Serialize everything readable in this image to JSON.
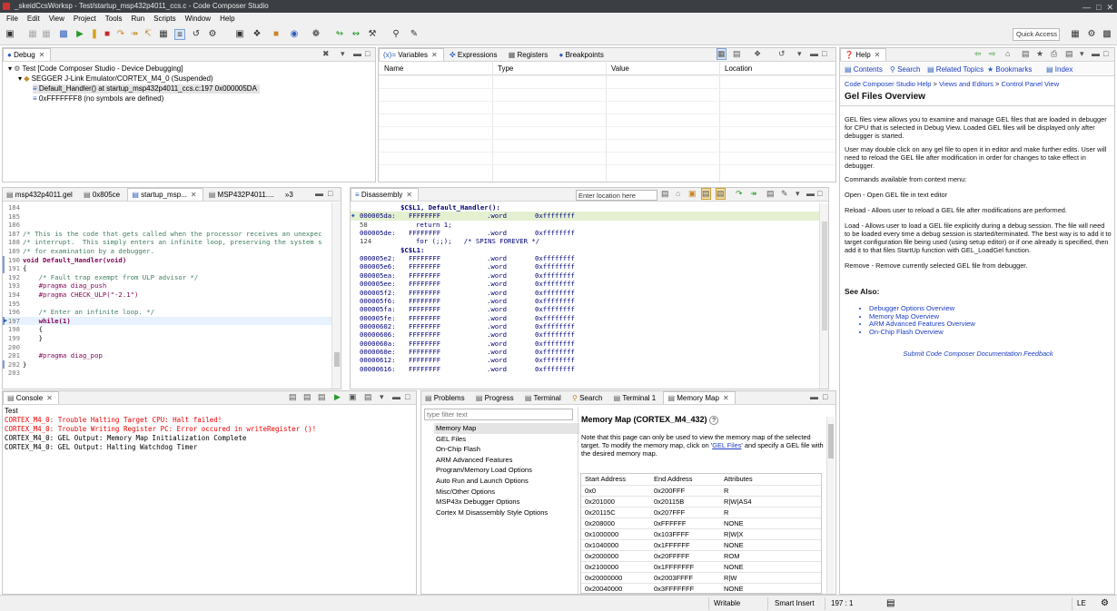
{
  "window": {
    "title": "_skeidCcsWorksp - Test/startup_msp432p4011_ccs.c - Code Composer Studio"
  },
  "menu": [
    "File",
    "Edit",
    "View",
    "Project",
    "Tools",
    "Run",
    "Scripts",
    "Window",
    "Help"
  ],
  "toolbar": {
    "quick_access": "Quick Access"
  },
  "debug": {
    "tab": "Debug",
    "tree": [
      "Test [Code Composer Studio - Device Debugging]",
      "SEGGER J-Link Emulator/CORTEX_M4_0 (Suspended)",
      "Default_Handler() at startup_msp432p4011_ccs.c:197 0x000005DA",
      "0xFFFFFFF8  (no symbols are defined)"
    ]
  },
  "variables": {
    "tabs": [
      "Variables",
      "Expressions",
      "Registers",
      "Breakpoints"
    ],
    "columns": [
      "Name",
      "Type",
      "Value",
      "Location"
    ]
  },
  "editor": {
    "tabs": [
      "msp432p4011.gel",
      "0x805ce",
      "startup_msp...",
      "MSP432P4011....",
      "»3"
    ],
    "lines": [
      {
        "n": "184",
        "t": ""
      },
      {
        "n": "185",
        "t": ""
      },
      {
        "n": "186",
        "t": ""
      },
      {
        "n": "187",
        "t": "/* This is the code that gets called when the processor receives an unexpec"
      },
      {
        "n": "188",
        "t": "/* interrupt.  This simply enters an infinite loop, preserving the system s"
      },
      {
        "n": "189",
        "t": "/* for examination by a debugger."
      },
      {
        "n": "190",
        "t": "void Default_Handler(void)"
      },
      {
        "n": "191",
        "t": "{"
      },
      {
        "n": "192",
        "t": "    /* Fault trap exempt from ULP advisor */"
      },
      {
        "n": "193",
        "t": "    #pragma diag_push"
      },
      {
        "n": "194",
        "t": "    #pragma CHECK_ULP(\"-2.1\")"
      },
      {
        "n": "195",
        "t": ""
      },
      {
        "n": "196",
        "t": "    /* Enter an infinite loop. */"
      },
      {
        "n": "197",
        "t": "    while(1)"
      },
      {
        "n": "198",
        "t": "    {"
      },
      {
        "n": "199",
        "t": "    }"
      },
      {
        "n": "200",
        "t": ""
      },
      {
        "n": "201",
        "t": "    #pragma diag_pop"
      },
      {
        "n": "202",
        "t": "}"
      },
      {
        "n": "203",
        "t": ""
      }
    ]
  },
  "disassembly": {
    "tab": "Disassembly",
    "location_placeholder": "Enter location here",
    "lines": [
      {
        "a": "",
        "b": "$C$L1, Default_Handler():",
        "c": "",
        "d": ""
      },
      {
        "a": "000005da:",
        "b": "FFFFFFFF",
        "c": ".word",
        "d": "0xffffffff"
      },
      {
        "a": "58",
        "b": "return 1;",
        "c": "",
        "d": ""
      },
      {
        "a": "000005de:",
        "b": "FFFFFFFF",
        "c": ".word",
        "d": "0xffffffff"
      },
      {
        "a": "124",
        "b": "for (;;);   /* SPINS FOREVER */",
        "c": "",
        "d": ""
      },
      {
        "a": "",
        "b": "$C$L1:",
        "c": "",
        "d": ""
      },
      {
        "a": "000005e2:",
        "b": "FFFFFFFF",
        "c": ".word",
        "d": "0xffffffff"
      },
      {
        "a": "000005e6:",
        "b": "FFFFFFFF",
        "c": ".word",
        "d": "0xffffffff"
      },
      {
        "a": "000005ea:",
        "b": "FFFFFFFF",
        "c": ".word",
        "d": "0xffffffff"
      },
      {
        "a": "000005ee:",
        "b": "FFFFFFFF",
        "c": ".word",
        "d": "0xffffffff"
      },
      {
        "a": "000005f2:",
        "b": "FFFFFFFF",
        "c": ".word",
        "d": "0xffffffff"
      },
      {
        "a": "000005f6:",
        "b": "FFFFFFFF",
        "c": ".word",
        "d": "0xffffffff"
      },
      {
        "a": "000005fa:",
        "b": "FFFFFFFF",
        "c": ".word",
        "d": "0xffffffff"
      },
      {
        "a": "000005fe:",
        "b": "FFFFFFFF",
        "c": ".word",
        "d": "0xffffffff"
      },
      {
        "a": "00000602:",
        "b": "FFFFFFFF",
        "c": ".word",
        "d": "0xffffffff"
      },
      {
        "a": "00000606:",
        "b": "FFFFFFFF",
        "c": ".word",
        "d": "0xffffffff"
      },
      {
        "a": "0000060a:",
        "b": "FFFFFFFF",
        "c": ".word",
        "d": "0xffffffff"
      },
      {
        "a": "0000060e:",
        "b": "FFFFFFFF",
        "c": ".word",
        "d": "0xffffffff"
      },
      {
        "a": "00000612:",
        "b": "FFFFFFFF",
        "c": ".word",
        "d": "0xffffffff"
      },
      {
        "a": "00000616:",
        "b": "FFFFFFFF",
        "c": ".word",
        "d": "0xffffffff"
      }
    ]
  },
  "help": {
    "tab": "Help",
    "nav": [
      "Contents",
      "Search",
      "Related Topics",
      "Bookmarks",
      "Index"
    ],
    "breadcrumb": [
      "Code Composer Studio Help",
      "Views and Editors",
      "Control Panel View"
    ],
    "breadcrumb_sep": " > ",
    "title": "Gel Files Overview",
    "p1": "GEL files view allows you to examine and manage GEL files that are loaded in debugger for CPU that is selected in Debug View. Loaded GEL files will be displayed only after debugger is started.",
    "p2": "User may double click on any gel file to open it in editor and make further edits. User will need to reload the GEL file after modification in order for changes to take effect in debugger.",
    "p3": "Commands available from context menu:",
    "p4": "Open - Open GEL file in text editor",
    "p5": "Reload - Allows user to reload a GEL file after modifications are performed.",
    "p6": "Load - Allows user to load a GEL file explicitly during a debug session. The file will need to be loaded every time a debug session is started/terminated. The best way is to add it to target configuration file being used (using setup editor) or if one already is specified, then add it to that files StartUp function with GEL_LoadGel function.",
    "p7": "Remove - Remove currently selected GEL file from debugger.",
    "see_also": "See Also:",
    "links": [
      "Debugger Options Overview",
      "Memory Map Overview",
      "ARM Advanced Features Overview",
      "On-Chip Flash Overview"
    ],
    "feedback": "Submit Code Composer Documentation Feedback"
  },
  "console": {
    "tab": "Console",
    "name": "Test",
    "lines": [
      {
        "t": "CORTEX_M4_0: Trouble Halting Target CPU: Halt failed!",
        "err": true
      },
      {
        "t": "CORTEX_M4_0: Trouble Writing Register PC: Error occured in writeRegister ()!",
        "err": true
      },
      {
        "t": "CORTEX_M4_0: GEL Output: Memory Map Initialization Complete",
        "err": false
      },
      {
        "t": "CORTEX_M4_0: GEL Output: Halting Watchdog Timer",
        "err": false
      }
    ]
  },
  "props": {
    "tabs": [
      "Problems",
      "Progress",
      "Terminal",
      "Search",
      "Terminal 1",
      "Memory Map"
    ],
    "filter_placeholder": "type filter text",
    "tree": [
      "Memory Map",
      "GEL Files",
      "On-Chip Flash",
      "ARM Advanced Features",
      "Program/Memory Load Options",
      "Auto Run and Launch Options",
      "Misc/Other Options",
      "MSP43x Debugger Options",
      "Cortex M Disassembly Style Options"
    ],
    "heading": "Memory Map (CORTEX_M4_432)",
    "note_a": "Note that this page can only be used to view the memory map of the selected target.  To modify the memory map, click on '",
    "note_link": "GEL Files",
    "note_b": "' and specify a GEL file with the desired memory map.",
    "columns": [
      "Start Address",
      "End Address",
      "Attributes"
    ],
    "rows": [
      [
        "0x0",
        "0x200FFF",
        "R"
      ],
      [
        "0x201000",
        "0x20115B",
        "R|W|AS4"
      ],
      [
        "0x20115C",
        "0x207FFF",
        "R"
      ],
      [
        "0x208000",
        "0xFFFFFF",
        "NONE"
      ],
      [
        "0x1000000",
        "0x103FFFF",
        "R|W|X"
      ],
      [
        "0x1040000",
        "0x1FFFFFF",
        "NONE"
      ],
      [
        "0x2000000",
        "0x20FFFFF",
        "ROM"
      ],
      [
        "0x2100000",
        "0x1FFFFFFF",
        "NONE"
      ],
      [
        "0x20000000",
        "0x2003FFFF",
        "R|W"
      ],
      [
        "0x20040000",
        "0x3FFFFFFF",
        "NONE"
      ]
    ]
  },
  "status": {
    "writable": "Writable",
    "insert": "Smart Insert",
    "position": "197 : 1",
    "le": "LE"
  }
}
